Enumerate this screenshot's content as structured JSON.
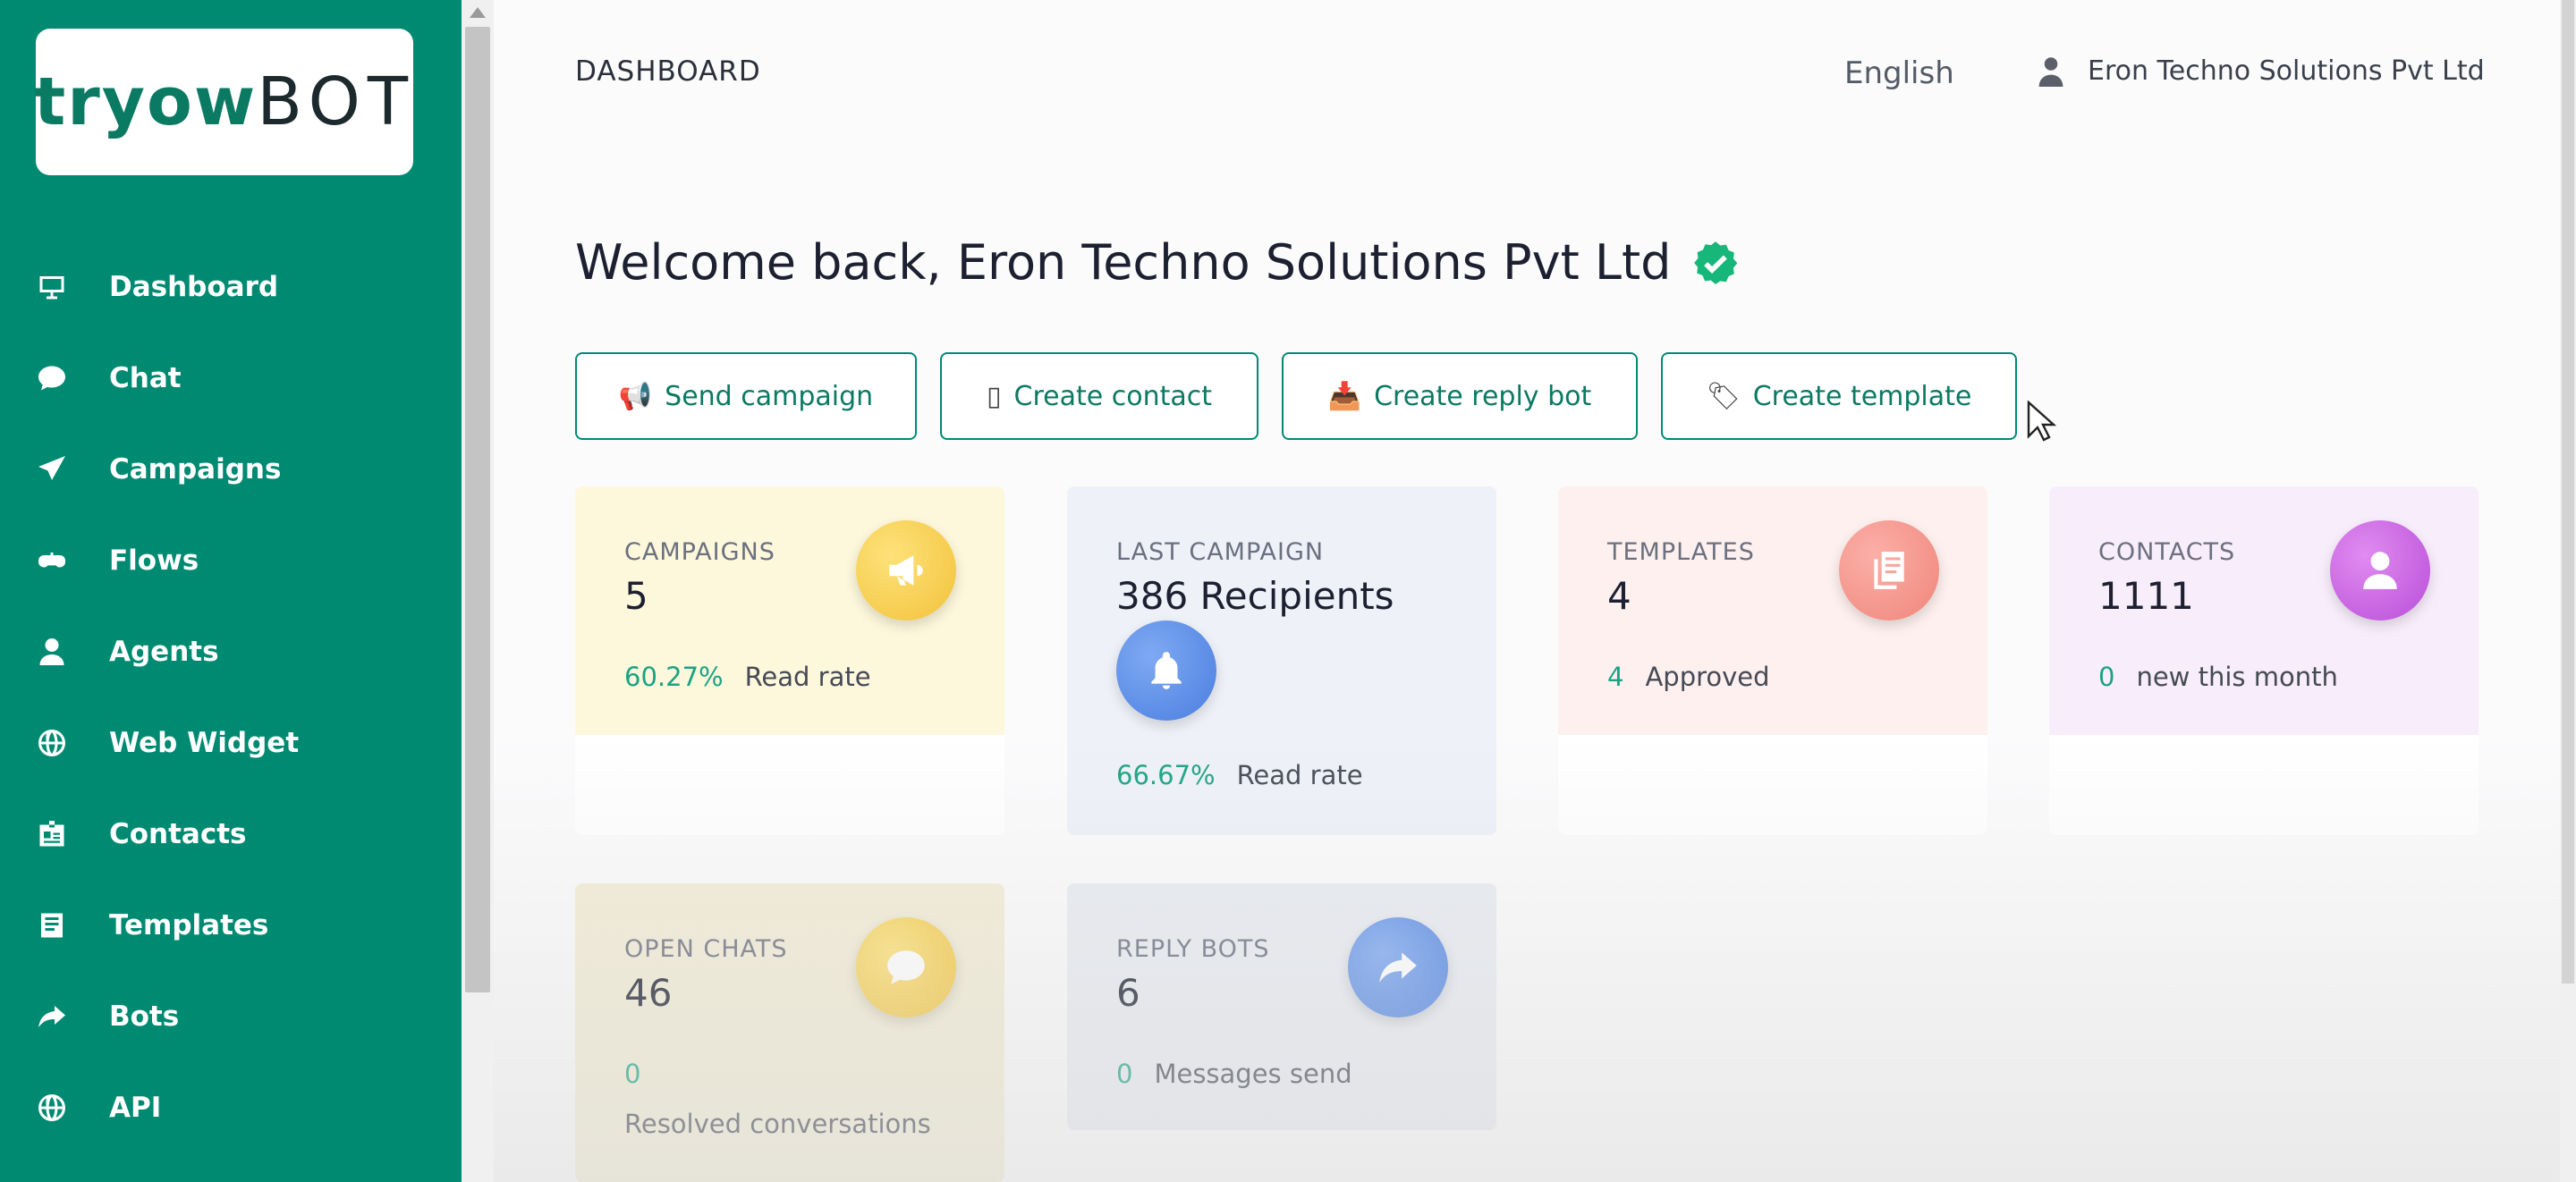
{
  "brand": {
    "logo_part1": "tryow",
    "logo_part2": "BOT"
  },
  "sidebar": {
    "items": [
      {
        "label": "Dashboard",
        "icon": "monitor-icon"
      },
      {
        "label": "Chat",
        "icon": "chat-bubble-icon"
      },
      {
        "label": "Campaigns",
        "icon": "paper-plane-icon"
      },
      {
        "label": "Flows",
        "icon": "gamepad-icon"
      },
      {
        "label": "Agents",
        "icon": "user-icon"
      },
      {
        "label": "Web Widget",
        "icon": "globe-icon"
      },
      {
        "label": "Contacts",
        "icon": "id-card-icon"
      },
      {
        "label": "Templates",
        "icon": "document-icon"
      },
      {
        "label": "Bots",
        "icon": "share-arrow-icon"
      },
      {
        "label": "API",
        "icon": "globe-icon"
      }
    ]
  },
  "header": {
    "title": "DASHBOARD",
    "language": "English",
    "user_name": "Eron Techno Solutions Pvt Ltd"
  },
  "welcome": {
    "text": "Welcome back, Eron Techno Solutions Pvt Ltd"
  },
  "actions": {
    "send_campaign": "Send campaign",
    "create_contact": "Create contact",
    "create_reply_bot": "Create reply bot",
    "create_template": "Create template",
    "icons": {
      "send_campaign": "📢",
      "create_contact": "▯",
      "create_reply_bot": "📥",
      "create_template": "🏷"
    }
  },
  "cards": {
    "campaigns": {
      "label": "CAMPAIGNS",
      "value": "5",
      "stat_num": "60.27%",
      "stat_text": "Read rate",
      "color": "#f5c842"
    },
    "last_campaign": {
      "label": "LAST CAMPAIGN",
      "value": "386 Recipients",
      "stat_num": "66.67%",
      "stat_text": "Read rate",
      "color": "#4a86e8"
    },
    "templates": {
      "label": "TEMPLATES",
      "value": "4",
      "stat_num": "4",
      "stat_text": "Approved",
      "color": "#f28b82"
    },
    "contacts": {
      "label": "CONTACTS",
      "value": "1111",
      "stat_num": "0",
      "stat_text": "new this month",
      "color": "#c75de0"
    },
    "open_chats": {
      "label": "OPEN CHATS",
      "value": "46",
      "stat_num": "0",
      "stat_text": "Resolved conversations",
      "color": "#f5c842"
    },
    "reply_bots": {
      "label": "REPLY BOTS",
      "value": "6",
      "stat_num": "0",
      "stat_text": "Messages send",
      "color": "#4a86e8"
    }
  }
}
